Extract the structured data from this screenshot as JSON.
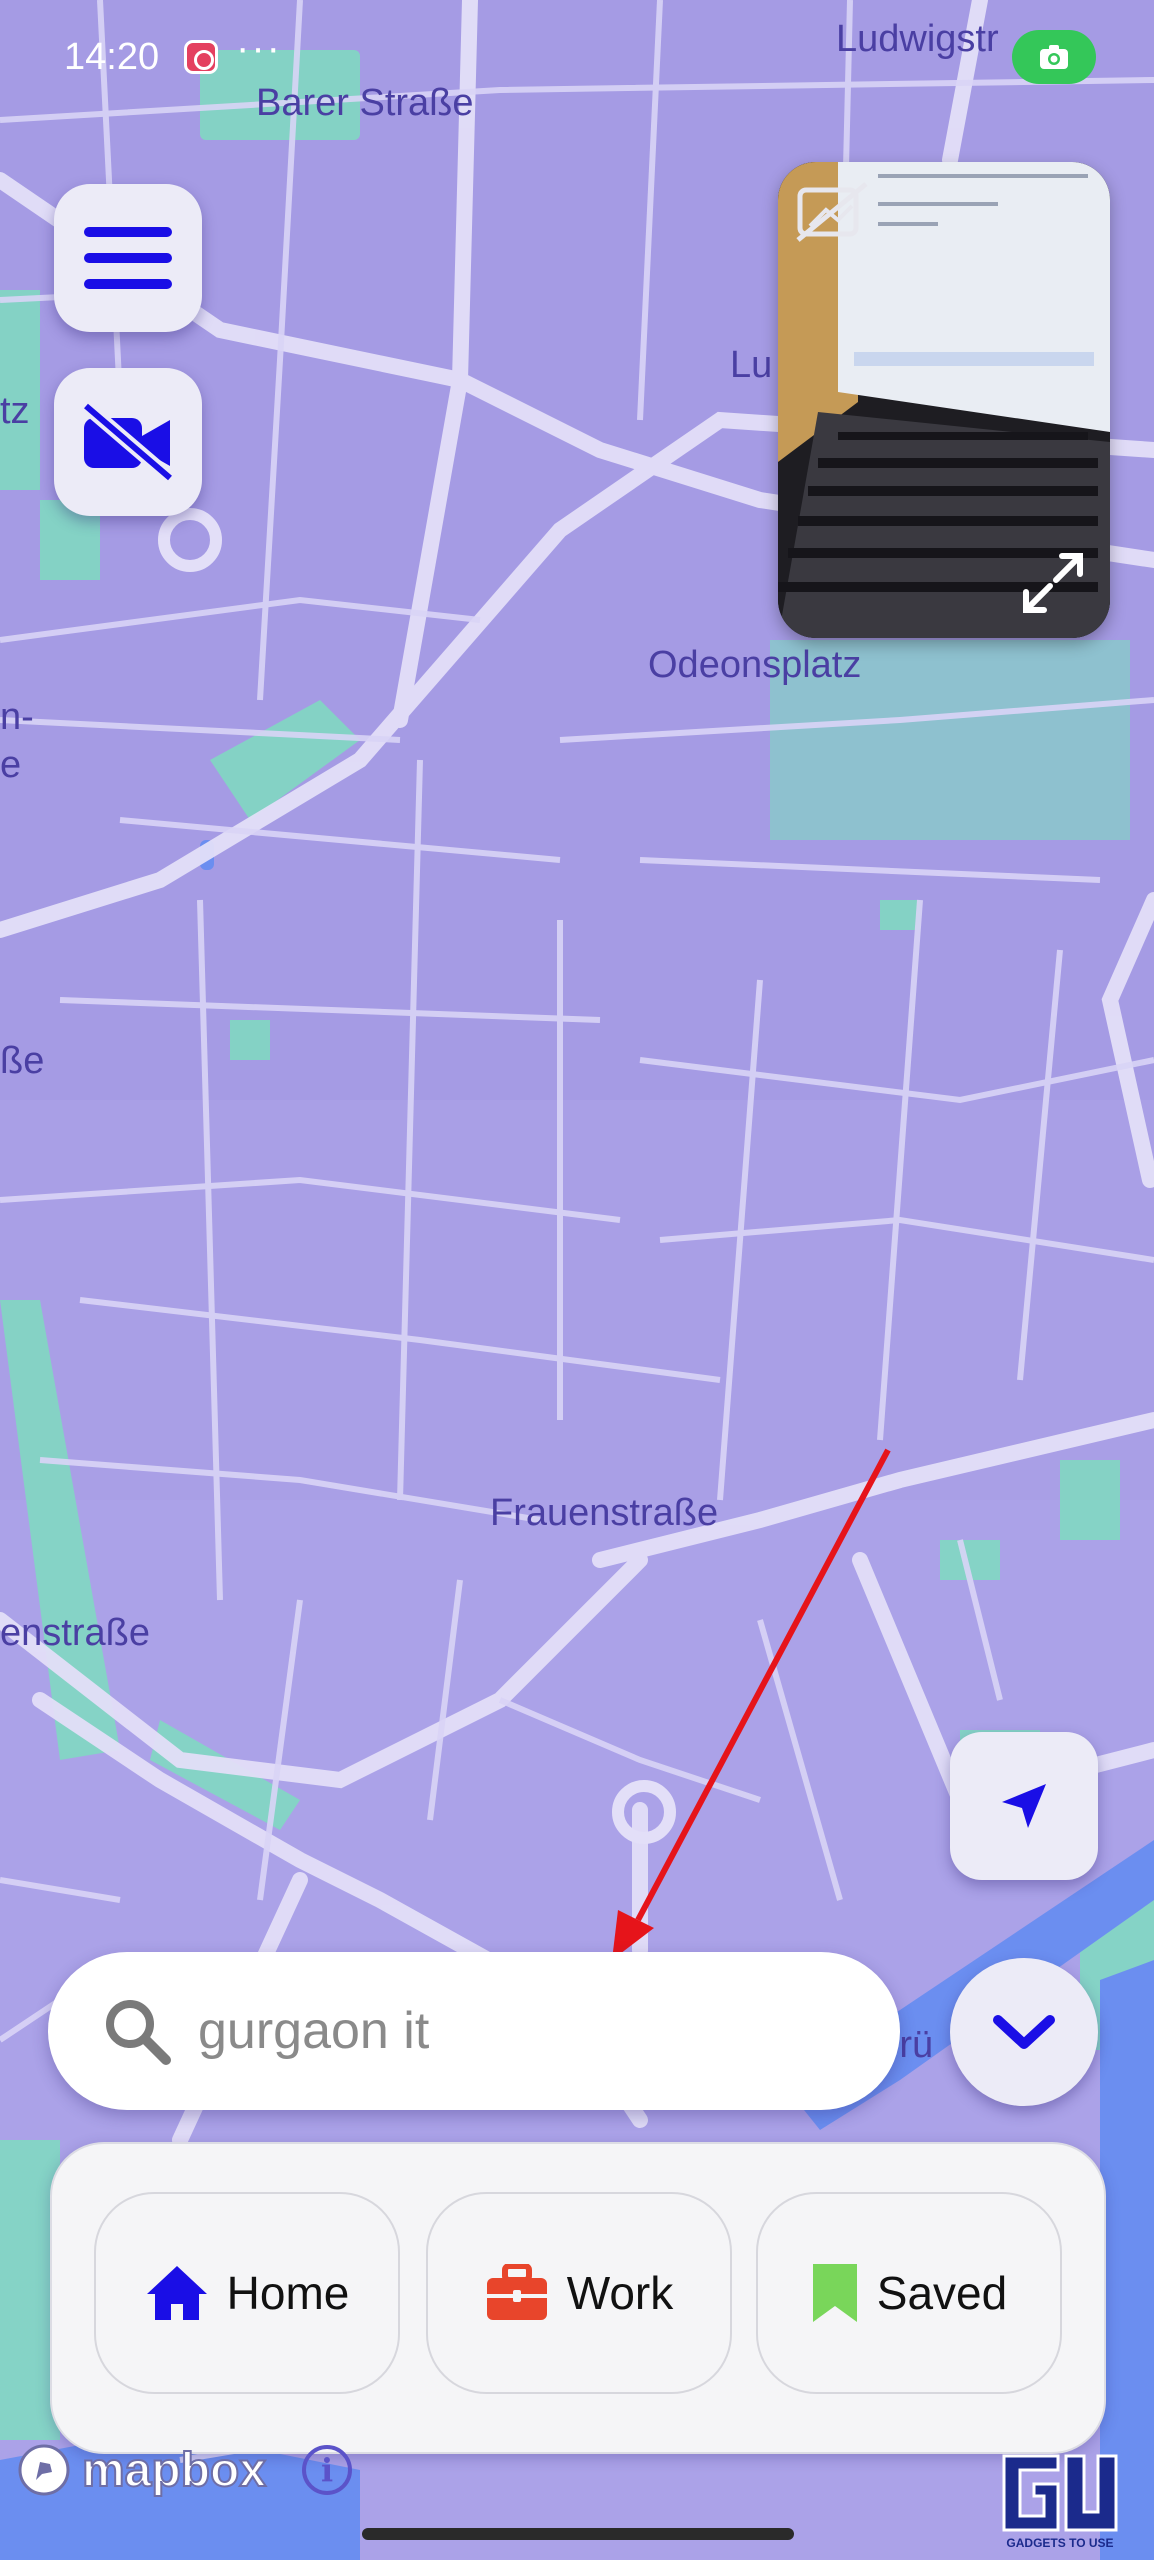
{
  "status_bar": {
    "time": "14:20",
    "notification_icons": [
      "instagram-icon"
    ],
    "overflow": "···",
    "camera_indicator_color": "#34c759"
  },
  "map": {
    "labels": {
      "barer": "Barer Straße",
      "ludwig": "Ludwigstr",
      "lu": "Lu",
      "odeon": "Odeonsplatz",
      "frauen": "Frauenstraße",
      "enstr": "enstraße",
      "left1": "tz",
      "left2": "n-",
      "left3": "e",
      "left4": "ße",
      "bru": "Brü"
    },
    "colors": {
      "background": "#a99fe6",
      "road": "#d9d4f6",
      "park": "#7fdcc0",
      "water": "#6b8ef0"
    }
  },
  "controls": {
    "menu_icon": "hamburger-icon",
    "video_icon": "video-off-icon",
    "locate_icon": "navigation-arrow-icon",
    "collapse_icon": "chevron-down-icon",
    "accent": "#1a0ee6"
  },
  "pip": {
    "camera_off_icon": "camera-off-icon",
    "expand_icon": "expand-icon"
  },
  "search": {
    "value": "gurgaon it"
  },
  "shortcuts": [
    {
      "label": "Home",
      "icon": "home-icon",
      "color": "#1a0ee6"
    },
    {
      "label": "Work",
      "icon": "briefcase-icon",
      "color": "#e8452b"
    },
    {
      "label": "Saved",
      "icon": "bookmark-icon",
      "color": "#79d65a"
    }
  ],
  "attribution": {
    "brand": "mapbox",
    "info": "i"
  },
  "watermark": {
    "text": "GADGETS TO USE"
  },
  "annotation": {
    "arrow_color": "#e6141a"
  }
}
